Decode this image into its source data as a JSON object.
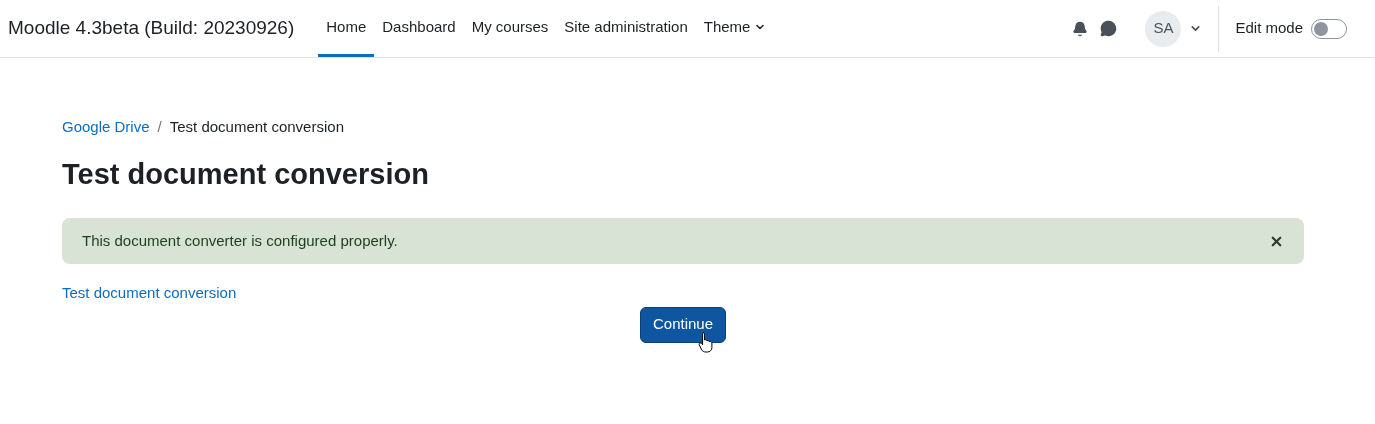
{
  "navbar": {
    "site_name": "Moodle 4.3beta (Build: 20230926)",
    "items": [
      {
        "label": "Home",
        "selected": true,
        "kind": "link"
      },
      {
        "label": "Dashboard",
        "selected": false,
        "kind": "link"
      },
      {
        "label": "My courses",
        "selected": false,
        "kind": "link"
      },
      {
        "label": "Site administration",
        "selected": false,
        "kind": "link"
      },
      {
        "label": "Theme",
        "selected": false,
        "kind": "dropdown"
      }
    ],
    "user_initials": "SA",
    "edit_mode": {
      "label": "Edit mode",
      "on": false
    }
  },
  "breadcrumb": [
    {
      "label": "Google Drive",
      "kind": "link"
    },
    {
      "label": "/",
      "kind": "separator"
    },
    {
      "label": "Test document conversion",
      "kind": "current"
    }
  ],
  "heading": "Test document conversion",
  "alert": {
    "message": "This document converter is configured properly."
  },
  "link": "Test document conversion",
  "button": "Continue"
}
